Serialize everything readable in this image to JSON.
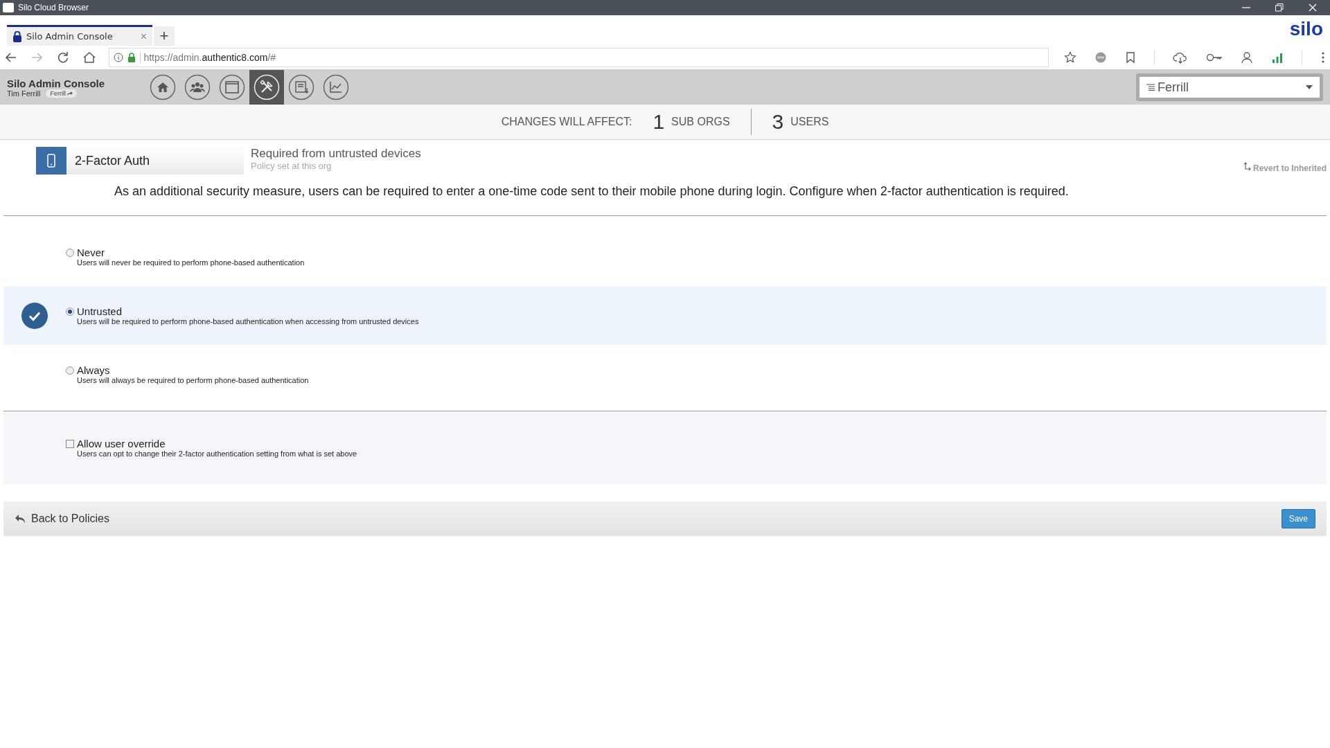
{
  "window": {
    "title": "Silo Cloud Browser",
    "logo": "silo"
  },
  "tabs": [
    {
      "label": "Silo Admin Console",
      "selected": true,
      "close": "×"
    }
  ],
  "new_tab": "+",
  "address": {
    "prefix": "https://admin.",
    "host": "authentic8.com",
    "suffix": "/#"
  },
  "console": {
    "title": "Silo Admin Console",
    "user": "Tim Ferrill",
    "org_chip": "Ferrill",
    "org_select": "Ferrill",
    "nav": [
      {
        "kind": "home",
        "selected": false
      },
      {
        "kind": "users",
        "selected": false
      },
      {
        "kind": "window",
        "selected": false
      },
      {
        "kind": "tools",
        "selected": true
      },
      {
        "kind": "export",
        "selected": false
      },
      {
        "kind": "chart",
        "selected": false
      }
    ]
  },
  "affect": {
    "label": "CHANGES WILL AFFECT:",
    "counts": [
      {
        "number": "1",
        "label": "SUB ORGS"
      },
      {
        "number": "3",
        "label": "USERS"
      }
    ]
  },
  "policy": {
    "name": "2-Factor Auth",
    "value": "Required from untrusted devices",
    "source": "Policy set at this org",
    "revert": "Revert to Inherited",
    "description": "As an additional security measure, users can be required to enter a one-time code sent to their mobile phone during login. Configure when 2-factor authentication is required."
  },
  "options": [
    {
      "label": "Never",
      "description": "Users will never be required to perform phone-based authentication",
      "selected": false
    },
    {
      "label": "Untrusted",
      "description": "Users will be required to perform phone-based authentication when accessing from untrusted devices",
      "selected": true
    },
    {
      "label": "Always",
      "description": "Users will always be required to perform phone-based authentication",
      "selected": false
    }
  ],
  "override": {
    "label": "Allow user override",
    "description": "Users can opt to change their 2-factor authentication setting from what is set above",
    "checked": false
  },
  "footer": {
    "back": "Back to Policies",
    "save": "Save"
  }
}
